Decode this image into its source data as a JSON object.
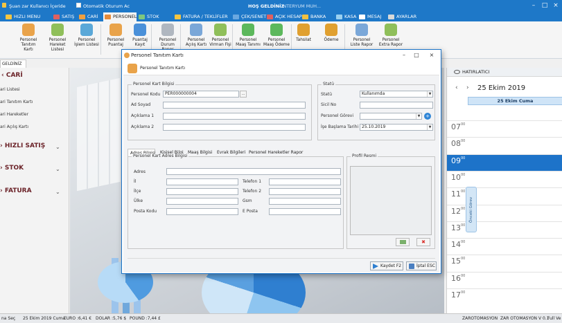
{
  "topbar": {
    "session_text": "Şuan zar Kullanıcı İçeride",
    "auto_logout": "Otomatik Oturum Ac",
    "welcome": "HOŞ GELDİNİZ",
    "welcome_user": "- INTERYUM MUH..."
  },
  "tabs": [
    {
      "label": "HIZLI MENU",
      "color": "#f4c542"
    },
    {
      "label": "SATIŞ",
      "color": "#e06060"
    },
    {
      "label": "CARİ",
      "color": "#f0a040"
    },
    {
      "label": "PERSONEL",
      "color": "#e58a3a"
    },
    {
      "label": "STOK",
      "color": "#7ec77e"
    },
    {
      "label": "FATURA / TEKLİFLER",
      "color": "#f4c542"
    },
    {
      "label": "ÇEK/SENET",
      "color": "#6aa8e0"
    },
    {
      "label": "AÇIK HESAP",
      "color": "#e06060"
    },
    {
      "label": "BANKA",
      "color": "#f0c040"
    },
    {
      "label": "KASA",
      "color": "#9ad0f0"
    },
    {
      "label": "MESAJ",
      "color": "#ffffff"
    },
    {
      "label": "AYARLAR",
      "color": "#d8d8d8"
    }
  ],
  "ribbon": [
    {
      "label": "Personel\nTanıtım Kartı",
      "icon": "person-card-icon",
      "color": "#e9a34a"
    },
    {
      "label": "Personel\nHareket Listesi",
      "icon": "person-movement-icon",
      "color": "#8fbf5a"
    },
    {
      "label": "Personel\nİşlem Listesi",
      "icon": "person-list-icon",
      "color": "#5aa8d8"
    },
    {
      "label": "Personel\nPuantaj",
      "icon": "timesheet-icon",
      "color": "#e9a34a"
    },
    {
      "label": "Puantaj\nKayıt",
      "icon": "add-record-icon",
      "color": "#4a90d9"
    },
    {
      "label": "Personel\nDurum Rapor",
      "icon": "status-report-icon",
      "color": "#b0b7c0"
    },
    {
      "label": "Personel\nAçılış Kartı",
      "icon": "opening-card-icon",
      "color": "#7aa7d8"
    },
    {
      "label": "Personel\nVirman Fişi",
      "icon": "transfer-slip-icon",
      "color": "#8fbf5a"
    },
    {
      "label": "Personel\nMaaş Tanımı",
      "icon": "salary-define-icon",
      "color": "#5cb85c"
    },
    {
      "label": "Personel\nMaaş Ödeme",
      "icon": "salary-payment-icon",
      "color": "#5cb85c"
    },
    {
      "label": "Tahsilat",
      "icon": "collection-icon",
      "color": "#e0a030"
    },
    {
      "label": "Ödeme",
      "icon": "payment-icon",
      "color": "#e0a030"
    },
    {
      "label": "Personel\nListe Rapor",
      "icon": "list-report-icon",
      "color": "#7aa7d8"
    },
    {
      "label": "Personel\nExtra Rapor",
      "icon": "extra-report-icon",
      "color": "#8fbf5a"
    }
  ],
  "doc_tab": "GELDİNİZ",
  "left_panel": {
    "cari_title": "CARİ",
    "cari_items": [
      "ari Listesi",
      "ari Tanıtım Kartı",
      "ari Hareketler",
      "ari Açılış Kartı"
    ],
    "hizli_satis": "HIZLI SATIŞ",
    "stok": "STOK",
    "fatura": "FATURA"
  },
  "calendar": {
    "header": "HATIRLATICI",
    "date_title": "25 Ekim 2019",
    "day_column": "25 Ekim Cuma",
    "hours": [
      "07",
      "08",
      "09",
      "10",
      "11",
      "12",
      "13",
      "14",
      "15",
      "16",
      "17"
    ],
    "minutes": "00",
    "current_hour": "09",
    "side_tab": "Önceki Görev"
  },
  "statusbar": {
    "lang": "na Seç",
    "date": "25 Ekim 2019 Cuma",
    "euro": "EURO :6,41 €",
    "dolar": "DOLAR :5,76 $",
    "pound": "POUND :7,44 £",
    "company": "ZAROTOMASYON",
    "version": "ZAR OTOMASYON V 0.1",
    "full": "Full Ve"
  },
  "dialog": {
    "title": "Personel Tanıtım Kartı",
    "header": "Personel Tanıtım Kartı",
    "kart_bilgisi": {
      "legend": "Personel Kart Bilgisi",
      "kod_label": "Personel Kodu",
      "kod_value": "PER000000004",
      "adsoyad_label": "Ad Soyad",
      "aciklama1_label": "Açıklama 1",
      "aciklama2_label": "Açıklama 2"
    },
    "statu": {
      "legend": "Statü",
      "statu_label": "Statü",
      "statu_value": "Kullanımda",
      "sicil_label": "Sicil No",
      "gorev_label": "Personel Görevi",
      "baslama_label": "İşe Başlama Tarihi",
      "baslama_value": "25.10.2019"
    },
    "tabs": [
      "Adres Bilgisi",
      "Kişisel Bilgi",
      "Maaş Bilgisi",
      "Evrak Bilgileri",
      "Personel Hareketler Rapor"
    ],
    "adres": {
      "legend": "Personel Kart Adres Bilgisi",
      "adres": "Adres",
      "il": "İl",
      "ilce": "İlçe",
      "ulke": "Ülke",
      "posta": "Posta Kodu",
      "tel1": "Telefon 1",
      "tel2": "Telefon 2",
      "gsm": "Gsm",
      "eposta": "E Posta"
    },
    "profil": "Profil Resmi",
    "save": "Kaydet F2",
    "cancel": "İptal ESC"
  }
}
